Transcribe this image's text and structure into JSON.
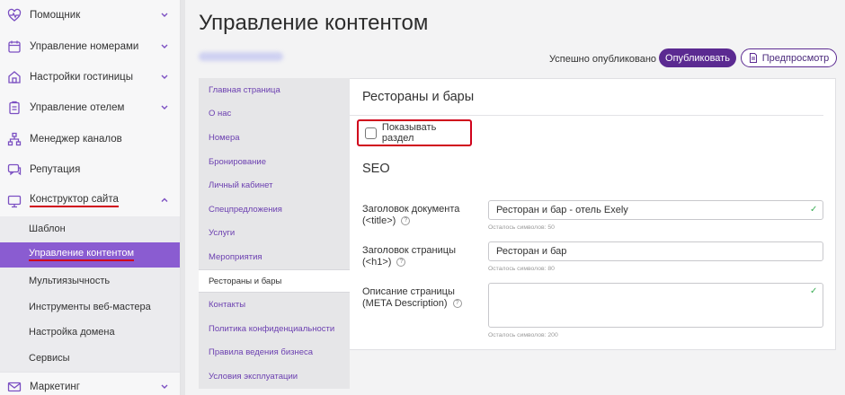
{
  "app": {
    "title": "Управление контентом"
  },
  "nav": {
    "items": [
      {
        "label": "Помощник",
        "icon": "heart-pulse-icon"
      },
      {
        "label": "Управление номерами",
        "icon": "calendar-icon"
      },
      {
        "label": "Настройки гостиницы",
        "icon": "home-icon"
      },
      {
        "label": "Управление отелем",
        "icon": "clipboard-icon"
      },
      {
        "label": "Менеджер каналов",
        "icon": "hierarchy-icon"
      },
      {
        "label": "Репутация",
        "icon": "chat-icon"
      },
      {
        "label": "Конструктор сайта",
        "icon": "monitor-icon"
      }
    ],
    "sub_items": [
      {
        "label": "Шаблон"
      },
      {
        "label": "Управление контентом"
      },
      {
        "label": "Мультиязычность"
      },
      {
        "label": "Инструменты веб-мастера"
      },
      {
        "label": "Настройка домена"
      },
      {
        "label": "Сервисы"
      }
    ],
    "last_item": {
      "label": "Маркетинг",
      "icon": "mail-icon"
    }
  },
  "toolbar": {
    "status": "Успешно опубликовано",
    "publish_label": "Опубликовать",
    "preview_label": "Предпросмотр"
  },
  "sections": [
    "Главная страница",
    "О нас",
    "Номера",
    "Бронирование",
    "Личный кабинет",
    "Спецпредложения",
    "Услуги",
    "Мероприятия",
    "Рестораны и бары",
    "Контакты",
    "Политика конфиденциальности",
    "Правила ведения бизнеса",
    "Условия эксплуатации"
  ],
  "active_section": "Рестораны и бары",
  "panel": {
    "title": "Рестораны и бары",
    "show_section_label": "Показывать раздел",
    "show_section_checked": false,
    "seo_title": "SEO",
    "fields": {
      "doc_title": {
        "label_line1": "Заголовок документа",
        "label_line2": "(<title>)",
        "value": "Ресторан и бар - отель Exely",
        "remaining": "Осталось символов: 50"
      },
      "h1": {
        "label_line1": "Заголовок страницы",
        "label_line2": "(<h1>)",
        "value": "Ресторан и бар",
        "remaining": "Осталось символов: 80"
      },
      "meta": {
        "label_line1": "Описание страницы",
        "label_line2": "(META Description)",
        "value": "",
        "remaining": "Осталось символов: 200"
      }
    },
    "help_glyph": "?",
    "ok_glyph": "✓"
  },
  "colors": {
    "accent": "#5b2a91",
    "active_sub": "#8a5cd1",
    "highlight": "#d0021b",
    "link": "#6b3fb0",
    "ok": "#3daf57"
  }
}
